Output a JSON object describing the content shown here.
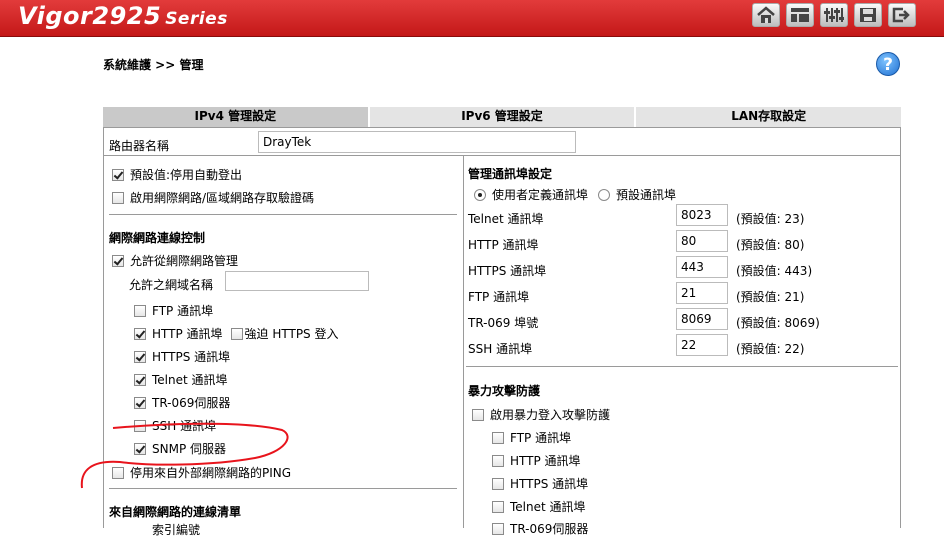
{
  "header": {
    "brand": "Vigor2925",
    "series": "Series",
    "icons": [
      "home-icon",
      "layout-icon",
      "sliders-icon",
      "save-icon",
      "logout-icon"
    ]
  },
  "breadcrumb": "系統維護 >> 管理",
  "help_icon": "?",
  "tabs": [
    {
      "label": "IPv4 管理設定",
      "active": true
    },
    {
      "label": "IPv6 管理設定",
      "active": false
    },
    {
      "label": "LAN存取設定",
      "active": false
    }
  ],
  "router_name": {
    "label": "路由器名稱",
    "value": "DrayTek"
  },
  "left": {
    "default_logout": {
      "label": "預設值:停用自動登出",
      "checked": true
    },
    "enable_validation": {
      "label": "啟用網際網路/區域網路存取驗證碼",
      "checked": false
    },
    "internet_section_title": "網際網路連線控制",
    "allow_mgmt": {
      "label": "允許從網際網路管理",
      "checked": true
    },
    "domain_label": "允許之網域名稱",
    "domain_value": "",
    "services": [
      {
        "label": "FTP 通訊埠",
        "checked": false
      },
      {
        "label": "HTTP 通訊埠",
        "checked": true
      },
      {
        "label": "HTTPS 通訊埠",
        "checked": true
      },
      {
        "label": "Telnet 通訊埠",
        "checked": true
      },
      {
        "label": "TR-069伺服器",
        "checked": true
      },
      {
        "label": "SSH 通訊埠",
        "checked": false
      },
      {
        "label": "SNMP 伺服器",
        "checked": true
      }
    ],
    "force_https": {
      "label": "強迫 HTTPS 登入",
      "checked": false
    },
    "disable_ping": {
      "label": "停用來自外部網際網路的PING",
      "checked": false
    },
    "access_list_title": "來自網際網路的連線清單",
    "access_list_partial": "索引編號"
  },
  "right": {
    "port_section_title": "管理通訊埠設定",
    "radio_custom": "使用者定義通訊埠",
    "radio_default": "預設通訊埠",
    "ports": [
      {
        "label": "Telnet 通訊埠",
        "value": "8023",
        "default": "(預設值: 23)"
      },
      {
        "label": "HTTP 通訊埠",
        "value": "80",
        "default": "(預設值: 80)"
      },
      {
        "label": "HTTPS 通訊埠",
        "value": "443",
        "default": "(預設值: 443)"
      },
      {
        "label": "FTP 通訊埠",
        "value": "21",
        "default": "(預設值: 21)"
      },
      {
        "label": "TR-069 埠號",
        "value": "8069",
        "default": "(預設值: 8069)"
      },
      {
        "label": "SSH 通訊埠",
        "value": "22",
        "default": "(預設值: 22)"
      }
    ],
    "brute_title": "暴力攻擊防護",
    "enable_brute": {
      "label": "啟用暴力登入攻擊防護",
      "checked": false
    },
    "brute_items": [
      {
        "label": "FTP 通訊埠",
        "checked": false
      },
      {
        "label": "HTTP 通訊埠",
        "checked": false
      },
      {
        "label": "HTTPS 通訊埠",
        "checked": false
      },
      {
        "label": "Telnet 通訊埠",
        "checked": false
      },
      {
        "label": "TR-069伺服器",
        "checked": false
      }
    ]
  },
  "colors": {
    "header_red": "#d42a2a",
    "annotation_red": "#e8141c",
    "help_blue": "#1f6fd1"
  }
}
